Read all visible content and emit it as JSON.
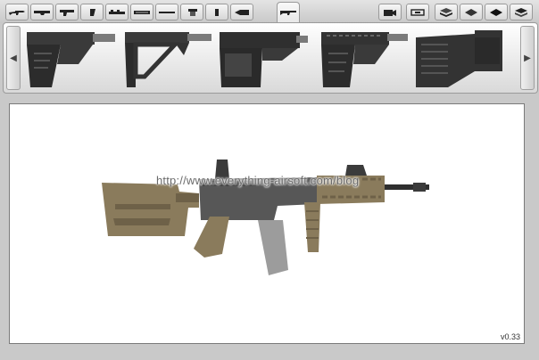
{
  "toolbar": {
    "categories": [
      {
        "icon": "rifle-icon"
      },
      {
        "icon": "upper-receiver-icon"
      },
      {
        "icon": "lower-receiver-icon"
      },
      {
        "icon": "grip-icon"
      },
      {
        "icon": "rail-mount-icon"
      },
      {
        "icon": "handguard-icon"
      },
      {
        "icon": "barrel-icon"
      },
      {
        "icon": "magazine-icon"
      },
      {
        "icon": "sling-icon"
      },
      {
        "icon": "muzzle-device-icon"
      },
      {
        "icon": "stock-icon"
      }
    ],
    "right_tools": [
      {
        "icon": "camera-icon"
      },
      {
        "icon": "fit-view-icon"
      },
      {
        "icon": "layer-stack-icon"
      },
      {
        "icon": "layer-diamond-icon"
      },
      {
        "icon": "layer-filled-icon"
      },
      {
        "icon": "layer-all-icon"
      }
    ]
  },
  "parts_tray": {
    "items": [
      {
        "icon": "m4-stock-icon"
      },
      {
        "icon": "skeleton-stock-icon"
      },
      {
        "icon": "crane-stock-icon"
      },
      {
        "icon": "ctr-stock-icon"
      },
      {
        "icon": "sniper-stock-icon"
      }
    ]
  },
  "canvas": {
    "watermark": "http://www.everything-airsoft.com/blog",
    "version": "v0.33",
    "colors": {
      "tan": "#8a7b5c",
      "tan_dark": "#6e6148",
      "gun_dark": "#3b3b3b",
      "gun_mid": "#575757",
      "barrel": "#2f2f2f"
    }
  }
}
